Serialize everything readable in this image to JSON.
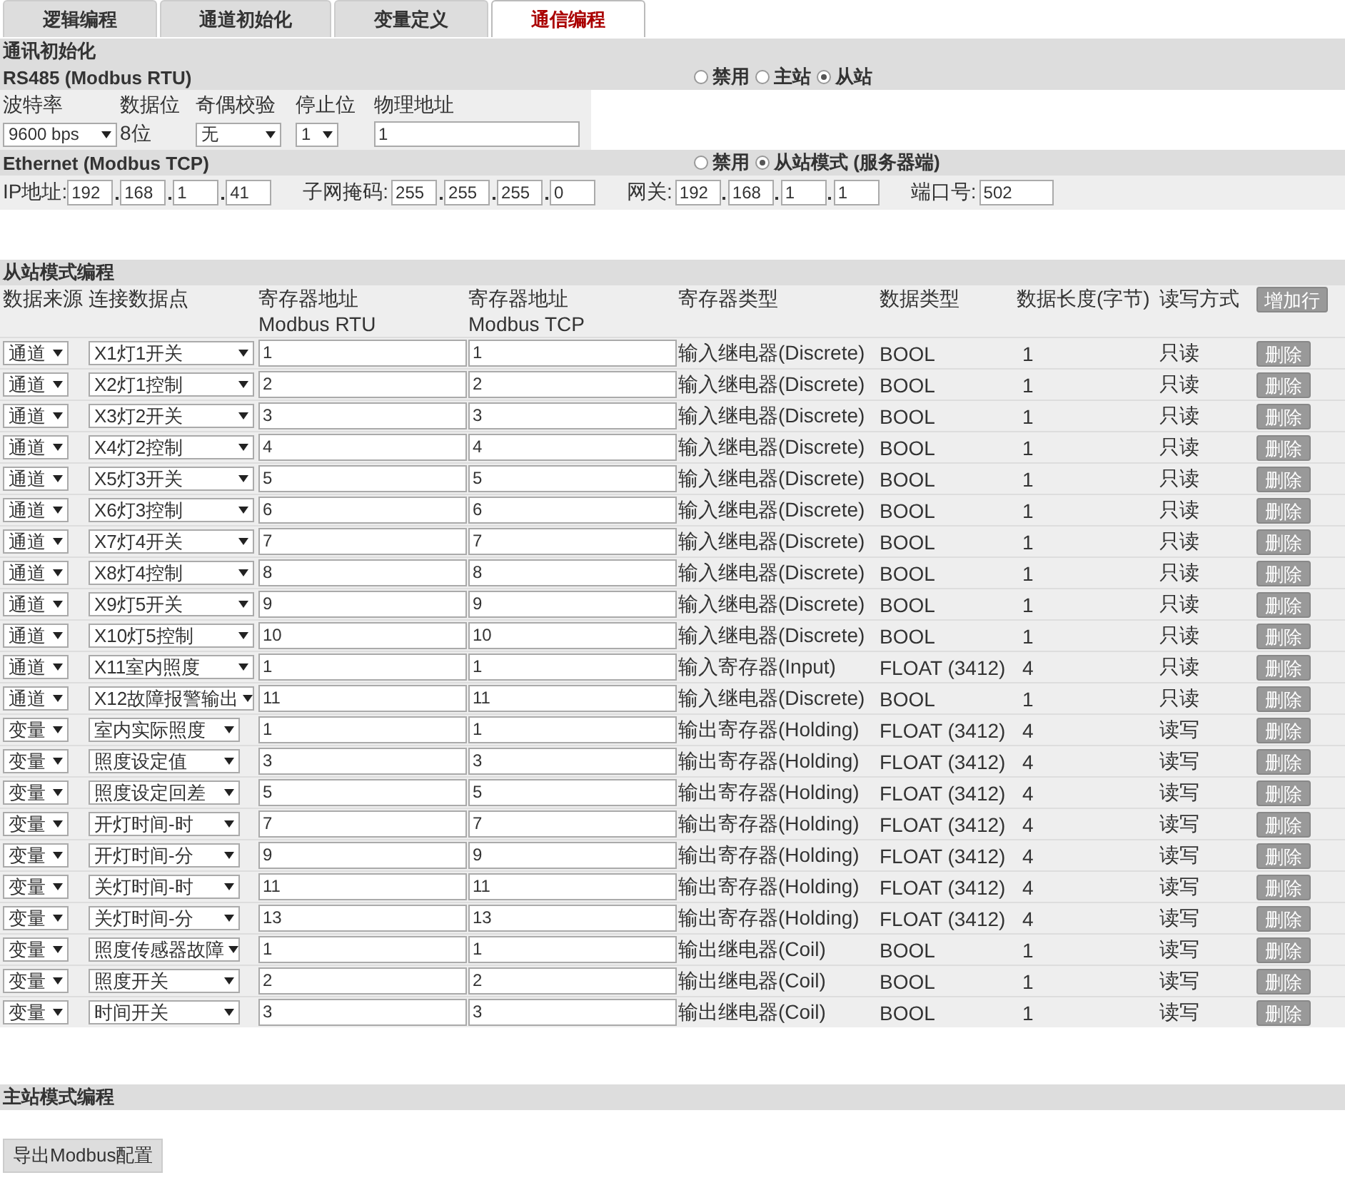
{
  "tabs": [
    {
      "label": "逻辑编程",
      "selected": false
    },
    {
      "label": "通道初始化",
      "selected": false
    },
    {
      "label": "变量定义",
      "selected": false
    },
    {
      "label": "通信编程",
      "selected": true
    }
  ],
  "comm_init": {
    "title": "通讯初始化",
    "rs485": {
      "title": "RS485 (Modbus RTU)",
      "modes": [
        {
          "label": "禁用",
          "selected": false
        },
        {
          "label": "主站",
          "selected": false
        },
        {
          "label": "从站",
          "selected": true
        }
      ],
      "labels": [
        "波特率",
        "数据位",
        "奇偶校验",
        "停止位",
        "物理地址"
      ],
      "baud_rate": "9600 bps",
      "data_bits": "8位",
      "parity": "无",
      "stop_bits": "1",
      "address": "1"
    },
    "ethernet": {
      "title": "Ethernet (Modbus TCP)",
      "modes": [
        {
          "label": "禁用",
          "selected": false
        },
        {
          "label": "从站模式 (服务器端)",
          "selected": true
        }
      ],
      "ip_label": "IP地址:",
      "ip": [
        "192",
        "168",
        "1",
        "41"
      ],
      "mask_label": "子网掩码:",
      "mask": [
        "255",
        "255",
        "255",
        "0"
      ],
      "gateway_label": "网关:",
      "gateway": [
        "192",
        "168",
        "1",
        "1"
      ],
      "port_label": "端口号:",
      "port": "502"
    }
  },
  "slave": {
    "title": "从站模式编程",
    "columns": [
      "数据来源",
      "连接数据点",
      "寄存器地址\nModbus RTU",
      "寄存器地址\nModbus TCP",
      "寄存器类型",
      "数据类型",
      "数据长度(字节)",
      "读写方式"
    ],
    "add_button": "增加行",
    "rows": [
      {
        "kind": "channel",
        "source": "通道",
        "point": "X1灯1开关",
        "rtu": "1",
        "tcp": "1",
        "reg_type": "输入继电器(Discrete)",
        "data_type": "BOOL",
        "length": "1",
        "access": "只读",
        "delete_button": "删除"
      },
      {
        "kind": "channel",
        "source": "通道",
        "point": "X2灯1控制",
        "rtu": "2",
        "tcp": "2",
        "reg_type": "输入继电器(Discrete)",
        "data_type": "BOOL",
        "length": "1",
        "access": "只读",
        "delete_button": "删除"
      },
      {
        "kind": "channel",
        "source": "通道",
        "point": "X3灯2开关",
        "rtu": "3",
        "tcp": "3",
        "reg_type": "输入继电器(Discrete)",
        "data_type": "BOOL",
        "length": "1",
        "access": "只读",
        "delete_button": "删除"
      },
      {
        "kind": "channel",
        "source": "通道",
        "point": "X4灯2控制",
        "rtu": "4",
        "tcp": "4",
        "reg_type": "输入继电器(Discrete)",
        "data_type": "BOOL",
        "length": "1",
        "access": "只读",
        "delete_button": "删除"
      },
      {
        "kind": "channel",
        "source": "通道",
        "point": "X5灯3开关",
        "rtu": "5",
        "tcp": "5",
        "reg_type": "输入继电器(Discrete)",
        "data_type": "BOOL",
        "length": "1",
        "access": "只读",
        "delete_button": "删除"
      },
      {
        "kind": "channel",
        "source": "通道",
        "point": "X6灯3控制",
        "rtu": "6",
        "tcp": "6",
        "reg_type": "输入继电器(Discrete)",
        "data_type": "BOOL",
        "length": "1",
        "access": "只读",
        "delete_button": "删除"
      },
      {
        "kind": "channel",
        "source": "通道",
        "point": "X7灯4开关",
        "rtu": "7",
        "tcp": "7",
        "reg_type": "输入继电器(Discrete)",
        "data_type": "BOOL",
        "length": "1",
        "access": "只读",
        "delete_button": "删除"
      },
      {
        "kind": "channel",
        "source": "通道",
        "point": "X8灯4控制",
        "rtu": "8",
        "tcp": "8",
        "reg_type": "输入继电器(Discrete)",
        "data_type": "BOOL",
        "length": "1",
        "access": "只读",
        "delete_button": "删除"
      },
      {
        "kind": "channel",
        "source": "通道",
        "point": "X9灯5开关",
        "rtu": "9",
        "tcp": "9",
        "reg_type": "输入继电器(Discrete)",
        "data_type": "BOOL",
        "length": "1",
        "access": "只读",
        "delete_button": "删除"
      },
      {
        "kind": "channel",
        "source": "通道",
        "point": "X10灯5控制",
        "rtu": "10",
        "tcp": "10",
        "reg_type": "输入继电器(Discrete)",
        "data_type": "BOOL",
        "length": "1",
        "access": "只读",
        "delete_button": "删除"
      },
      {
        "kind": "channel",
        "source": "通道",
        "point": "X11室内照度",
        "rtu": "1",
        "tcp": "1",
        "reg_type": "输入寄存器(Input)",
        "data_type": "FLOAT (3412)",
        "length": "4",
        "access": "只读",
        "delete_button": "删除"
      },
      {
        "kind": "channel",
        "source": "通道",
        "point": "X12故障报警输出",
        "rtu": "11",
        "tcp": "11",
        "reg_type": "输入继电器(Discrete)",
        "data_type": "BOOL",
        "length": "1",
        "access": "只读",
        "delete_button": "删除"
      },
      {
        "kind": "variable",
        "source": "变量",
        "point": "室内实际照度",
        "rtu": "1",
        "tcp": "1",
        "reg_type": "输出寄存器(Holding)",
        "data_type": "FLOAT (3412)",
        "length": "4",
        "access": "读写",
        "delete_button": "删除"
      },
      {
        "kind": "variable",
        "source": "变量",
        "point": "照度设定值",
        "rtu": "3",
        "tcp": "3",
        "reg_type": "输出寄存器(Holding)",
        "data_type": "FLOAT (3412)",
        "length": "4",
        "access": "读写",
        "delete_button": "删除"
      },
      {
        "kind": "variable",
        "source": "变量",
        "point": "照度设定回差",
        "rtu": "5",
        "tcp": "5",
        "reg_type": "输出寄存器(Holding)",
        "data_type": "FLOAT (3412)",
        "length": "4",
        "access": "读写",
        "delete_button": "删除"
      },
      {
        "kind": "variable",
        "source": "变量",
        "point": "开灯时间-时",
        "rtu": "7",
        "tcp": "7",
        "reg_type": "输出寄存器(Holding)",
        "data_type": "FLOAT (3412)",
        "length": "4",
        "access": "读写",
        "delete_button": "删除"
      },
      {
        "kind": "variable",
        "source": "变量",
        "point": "开灯时间-分",
        "rtu": "9",
        "tcp": "9",
        "reg_type": "输出寄存器(Holding)",
        "data_type": "FLOAT (3412)",
        "length": "4",
        "access": "读写",
        "delete_button": "删除"
      },
      {
        "kind": "variable",
        "source": "变量",
        "point": "关灯时间-时",
        "rtu": "11",
        "tcp": "11",
        "reg_type": "输出寄存器(Holding)",
        "data_type": "FLOAT (3412)",
        "length": "4",
        "access": "读写",
        "delete_button": "删除"
      },
      {
        "kind": "variable",
        "source": "变量",
        "point": "关灯时间-分",
        "rtu": "13",
        "tcp": "13",
        "reg_type": "输出寄存器(Holding)",
        "data_type": "FLOAT (3412)",
        "length": "4",
        "access": "读写",
        "delete_button": "删除"
      },
      {
        "kind": "variable",
        "source": "变量",
        "point": "照度传感器故障",
        "rtu": "1",
        "tcp": "1",
        "reg_type": "输出继电器(Coil)",
        "data_type": "BOOL",
        "length": "1",
        "access": "读写",
        "delete_button": "删除"
      },
      {
        "kind": "variable",
        "source": "变量",
        "point": "照度开关",
        "rtu": "2",
        "tcp": "2",
        "reg_type": "输出继电器(Coil)",
        "data_type": "BOOL",
        "length": "1",
        "access": "读写",
        "delete_button": "删除"
      },
      {
        "kind": "variable",
        "source": "变量",
        "point": "时间开关",
        "rtu": "3",
        "tcp": "3",
        "reg_type": "输出继电器(Coil)",
        "data_type": "BOOL",
        "length": "1",
        "access": "读写",
        "delete_button": "删除"
      }
    ]
  },
  "master": {
    "title": "主站模式编程"
  },
  "export_button": "导出Modbus配置"
}
